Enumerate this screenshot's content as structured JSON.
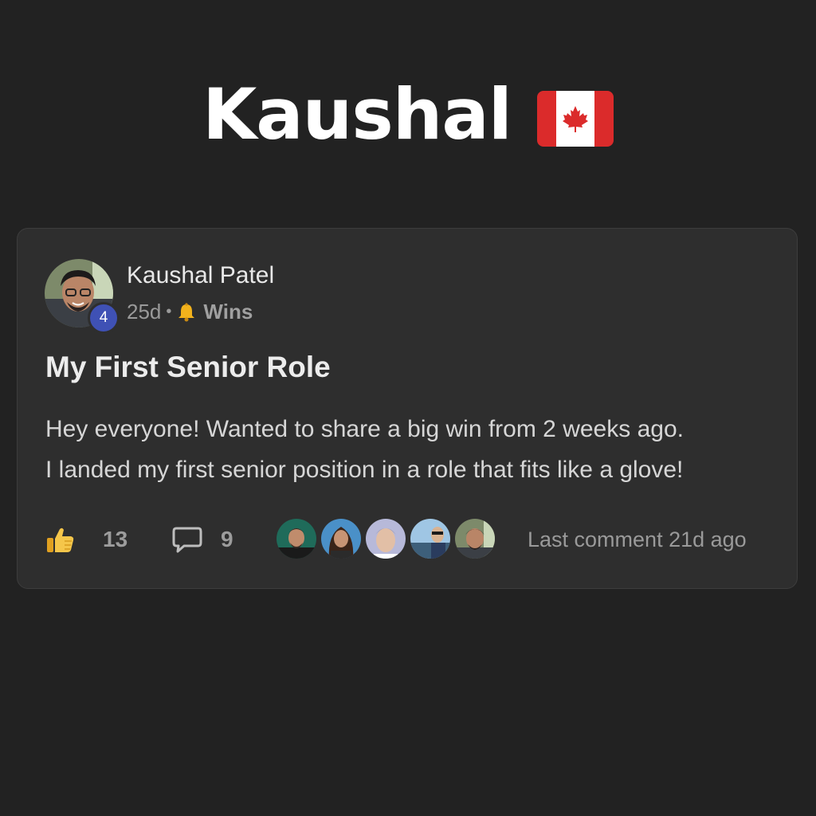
{
  "header": {
    "title": "Kaushal",
    "flag_icon": "canada-flag-icon"
  },
  "post": {
    "author": {
      "name": "Kaushal Patel",
      "level": "4",
      "avatar_icon": "user-avatar"
    },
    "meta": {
      "age": "25d",
      "separator": "•",
      "category_icon": "bell-icon",
      "category": "Wins"
    },
    "title": "My First Senior Role",
    "body_lines": [
      "Hey everyone! Wanted to share a big win from 2 weeks ago.",
      "I landed my first senior position in a role that fits like a glove!"
    ],
    "stats": {
      "likes": "13",
      "comments": "9"
    },
    "last_comment": "Last comment 21d ago"
  },
  "colors": {
    "background": "#222222",
    "card": "#2e2e2e",
    "badge": "#3f51b5",
    "flag_red": "#db2b2b"
  }
}
